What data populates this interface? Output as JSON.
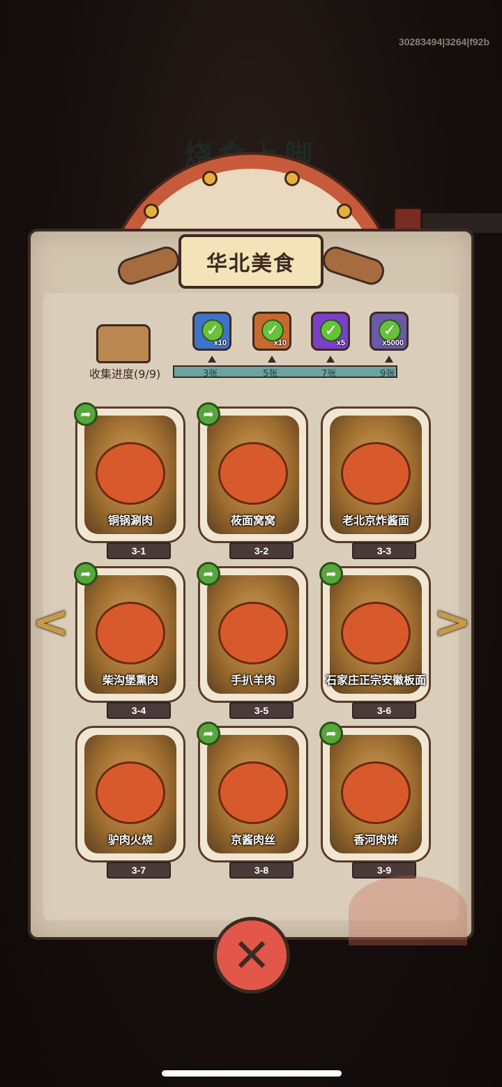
{
  "build_id": "30283494|3264|f92b",
  "background": {
    "ghost_title": "烧食上脚"
  },
  "header": {
    "title": "华北美食"
  },
  "collection": {
    "label": "收集进度(9/9)",
    "milestones": [
      {
        "label": "3张",
        "reward_icon": "cloth-icon",
        "qty": "x10",
        "color": "#3f73c9"
      },
      {
        "label": "5张",
        "reward_icon": "key-icon",
        "qty": "x10",
        "color": "#c86a2e"
      },
      {
        "label": "7张",
        "reward_icon": "orb-icon",
        "qty": "x5",
        "color": "#7a3fc9"
      },
      {
        "label": "9张",
        "reward_icon": "stone-icon",
        "qty": "x5000",
        "color": "#6a5aa8"
      }
    ]
  },
  "dishes": [
    {
      "name": "铜锅涮肉",
      "code": "3-1",
      "shareable": true
    },
    {
      "name": "莜面窝窝",
      "code": "3-2",
      "shareable": true
    },
    {
      "name": "老北京炸酱面",
      "code": "3-3",
      "shareable": false
    },
    {
      "name": "柴沟堡熏肉",
      "code": "3-4",
      "shareable": true
    },
    {
      "name": "手扒羊肉",
      "code": "3-5",
      "shareable": true
    },
    {
      "name": "石家庄正宗安徽板面",
      "code": "3-6",
      "shareable": true
    },
    {
      "name": "驴肉火烧",
      "code": "3-7",
      "shareable": false
    },
    {
      "name": "京酱肉丝",
      "code": "3-8",
      "shareable": true
    },
    {
      "name": "香河肉饼",
      "code": "3-9",
      "shareable": true
    }
  ],
  "nav": {
    "prev": "<",
    "next": ">"
  },
  "close_button": {
    "label": "✕"
  }
}
